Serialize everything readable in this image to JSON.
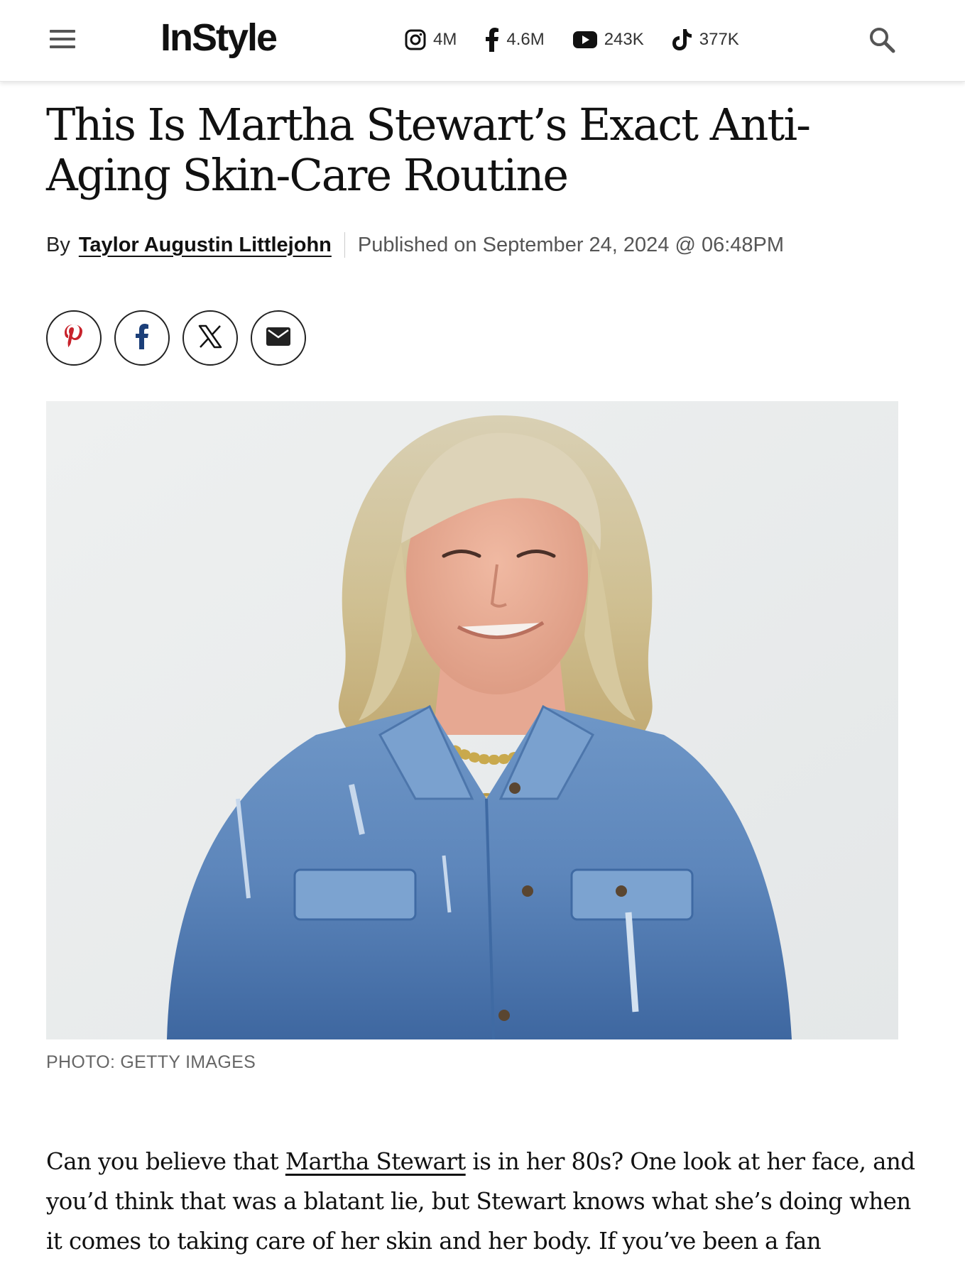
{
  "header": {
    "logo": "InStyle",
    "social": [
      {
        "network": "instagram",
        "icon": "instagram-icon",
        "count": "4M"
      },
      {
        "network": "facebook",
        "icon": "facebook-icon",
        "count": "4.6M"
      },
      {
        "network": "youtube",
        "icon": "youtube-icon",
        "count": "243K"
      },
      {
        "network": "tiktok",
        "icon": "tiktok-icon",
        "count": "377K"
      }
    ],
    "menu_icon": "hamburger-menu-icon",
    "search_icon": "search-icon"
  },
  "article": {
    "title": "This Is Martha Stewart’s Exact Anti-Aging Skin-Care Routine",
    "byline": {
      "by": "By",
      "author": "Taylor Augustin Littlejohn",
      "published": "Published on September 24, 2024 @ 06:48PM"
    },
    "share": [
      {
        "network": "pinterest",
        "icon": "pinterest-icon",
        "color": "#c8232c"
      },
      {
        "network": "facebook",
        "icon": "facebook-icon",
        "color": "#1c3f79"
      },
      {
        "network": "x",
        "icon": "x-icon",
        "color": "#111111"
      },
      {
        "network": "email",
        "icon": "email-icon",
        "color": "#222222"
      }
    ],
    "hero_caption": "PHOTO: GETTY IMAGES",
    "intro": {
      "before_link": "Can you believe that ",
      "link": "Martha Stewart",
      "after_link": " is in her 80s? One look at her face, and you’d think that was a blatant lie, but Stewart knows what she’s doing when it comes to taking care of her skin and her body. If you’ve been a fan"
    }
  },
  "colors": {
    "accent": "#111111",
    "pinterest": "#c8232c",
    "facebook": "#1c3f79",
    "muted_text": "#666666"
  }
}
